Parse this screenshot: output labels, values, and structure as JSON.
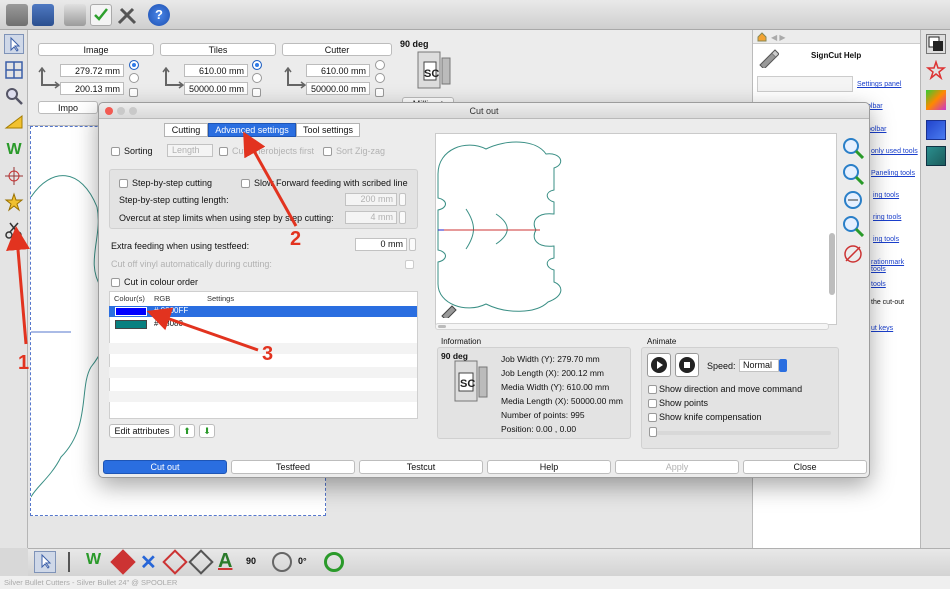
{
  "toolbar": {
    "icons": [
      "folder-icon",
      "save-icon",
      "printer-icon",
      "checklist-icon",
      "tools-icon",
      "help-icon"
    ]
  },
  "left_tools": {
    "icons": [
      "pointer-icon",
      "grid-icon",
      "zoom-icon",
      "ruler-icon",
      "weed-icon",
      "crosshair-icon",
      "star-icon",
      "scissors-icon"
    ]
  },
  "properties": {
    "image": {
      "title": "Image",
      "width": "279.72 mm",
      "height": "200.13 mm",
      "import_label": "Impo"
    },
    "tiles": {
      "title": "Tiles",
      "width": "610.00 mm",
      "height": "50000.00 mm"
    },
    "cutter": {
      "title": "Cutter",
      "width": "610.00 mm",
      "height": "50000.00 mm"
    },
    "rotation": "90 deg",
    "media_label": "Millimet"
  },
  "help_panel": {
    "title": "SignCut Help",
    "links": [
      "Settings panel",
      "olbar",
      "oolbar",
      "only used tools",
      "Paneling tools",
      "ing tools",
      "ring tools",
      "ing tools",
      "rationmark tools",
      "tools",
      "the cut-out",
      "ut keys"
    ]
  },
  "dialog": {
    "title": "Cut out",
    "tabs": [
      {
        "label": "Cutting",
        "active": false
      },
      {
        "label": "Advanced settings",
        "active": true
      },
      {
        "label": "Tool settings",
        "active": false
      }
    ],
    "sorting": {
      "label": "Sorting",
      "select_value": "Length",
      "cut_innerobjects_label": "Cut innerobjects first",
      "sort_zigzag_label": "Sort Zig-zag"
    },
    "step": {
      "step_by_step_label": "Step-by-step cutting",
      "slow_forward_label": "Slow Forward feeding with scribed line",
      "length_label": "Step-by-step cutting length:",
      "length_value": "200 mm",
      "overcut_label": "Overcut at step limits when using step by step cutting:",
      "overcut_value": "4 mm"
    },
    "extra_feeding": {
      "label": "Extra feeding when using testfeed:",
      "value": "0 mm"
    },
    "cutoff_label": "Cut off vinyl automatically during cutting:",
    "colour_order": {
      "label": "Cut in colour order",
      "headers": [
        "Colour(s)",
        "RGB",
        "Settings"
      ],
      "rows": [
        {
          "color": "#0000ff",
          "rgb": "# 0000FF",
          "selected": true
        },
        {
          "color": "#088080",
          "rgb": "# 08080",
          "selected": false
        }
      ],
      "edit_attributes_label": "Edit attributes"
    },
    "information": {
      "title": "Information",
      "rotation": "90 deg",
      "job_width": "Job Width (Y): 279.70 mm",
      "job_length": "Job Length (X): 200.12 mm",
      "media_width": "Media Width (Y): 610.00 mm",
      "media_length": "Media Length (X): 50000.00 mm",
      "points": "Number of points: 995",
      "position": "Position: 0.00 , 0.00"
    },
    "animate": {
      "title": "Animate",
      "speed_label": "Speed:",
      "speed_value": "Normal",
      "options": [
        "Show direction and move command",
        "Show points",
        "Show knife compensation"
      ]
    },
    "buttons": {
      "cut_out": "Cut out",
      "testfeed": "Testfeed",
      "testcut": "Testcut",
      "help": "Help",
      "apply": "Apply",
      "close": "Close"
    }
  },
  "annotations": {
    "n1": "1",
    "n2": "2",
    "n3": "3"
  },
  "bottom_tools": {
    "rotation": "90",
    "angle": "0°"
  },
  "status": "Silver Bullet Cutters - Silver Bullet 24\" @ SPOOLER",
  "colors": {
    "accent": "#2a6ee0",
    "arrow": "#e2331f",
    "outline": "#3a8f85"
  }
}
